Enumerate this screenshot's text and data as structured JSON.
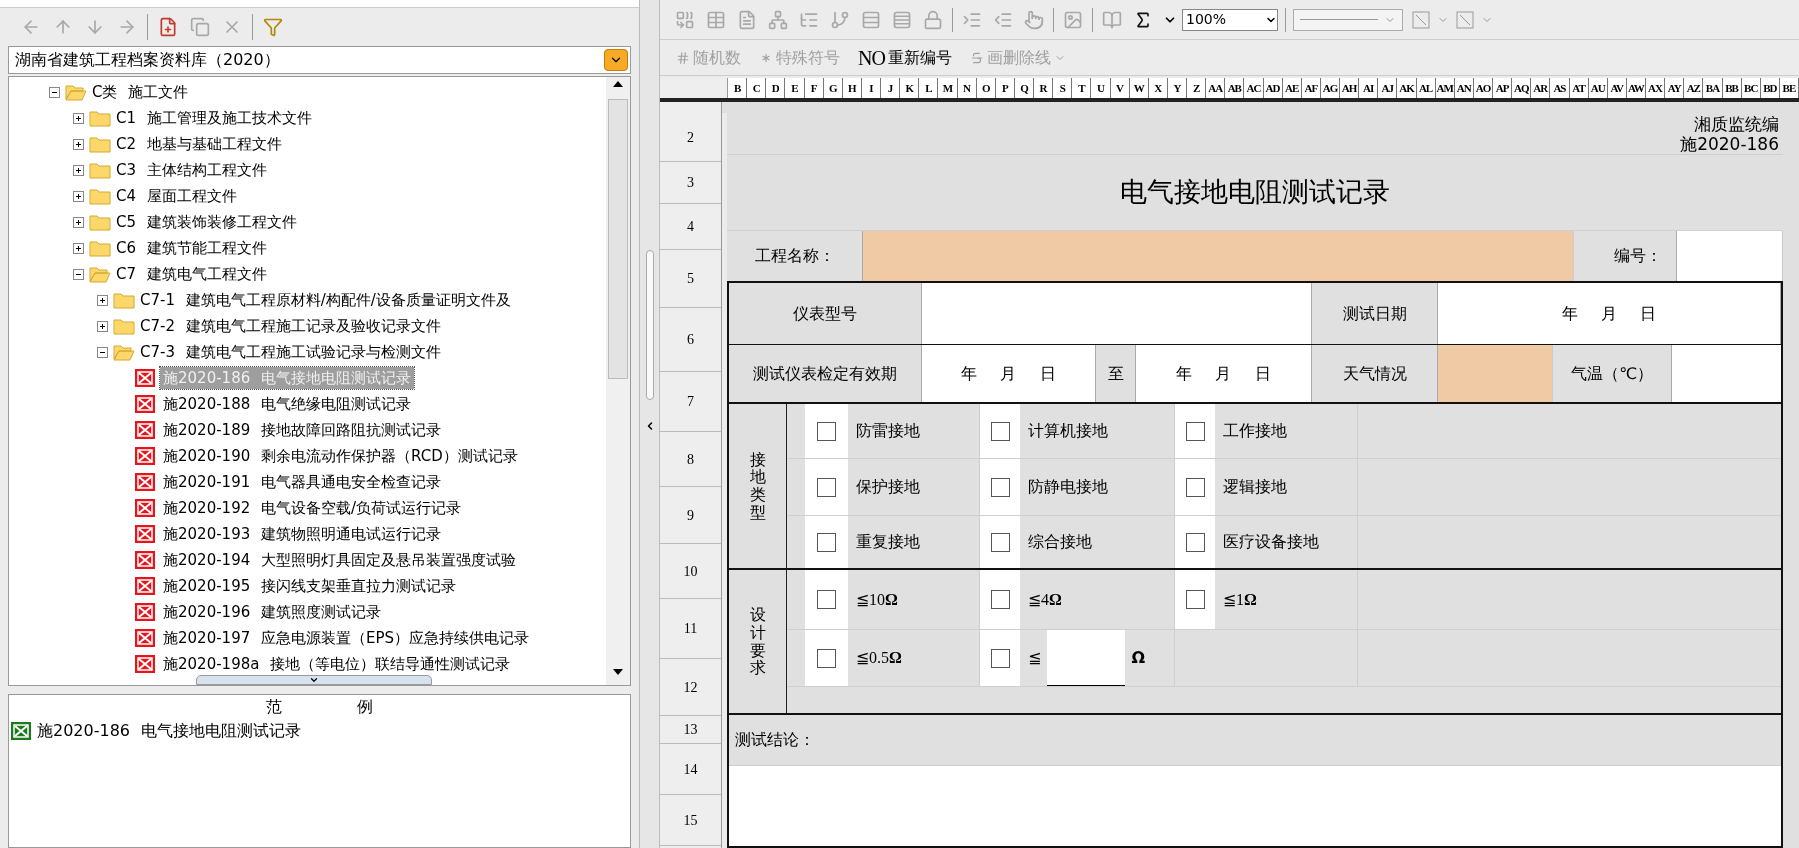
{
  "left_toolbar": [
    {
      "kind": "arrow-left",
      "disabled": true
    },
    {
      "kind": "arrow-up",
      "disabled": true
    },
    {
      "kind": "arrow-down",
      "disabled": true
    },
    {
      "kind": "arrow-right",
      "disabled": true
    },
    {
      "kind": "new-document",
      "disabled": false
    },
    {
      "kind": "copy",
      "disabled": true
    },
    {
      "kind": "delete",
      "disabled": true
    },
    {
      "kind": "filter",
      "disabled": false
    }
  ],
  "library_select": {
    "value": "湖南省建筑工程档案资料库（2020）"
  },
  "tree": [
    {
      "kind": "folder",
      "label": "C类 施工文件",
      "expanded": true,
      "children": [
        {
          "kind": "folder",
          "label": "C1 施工管理及施工技术文件",
          "expanded": false
        },
        {
          "kind": "folder",
          "label": "C2 地基与基础工程文件",
          "expanded": false
        },
        {
          "kind": "folder",
          "label": "C3 主体结构工程文件",
          "expanded": false
        },
        {
          "kind": "folder",
          "label": "C4 屋面工程文件",
          "expanded": false
        },
        {
          "kind": "folder",
          "label": "C5 建筑装饰装修工程文件",
          "expanded": false
        },
        {
          "kind": "folder",
          "label": "C6 建筑节能工程文件",
          "expanded": false
        },
        {
          "kind": "folder",
          "label": "C7 建筑电气工程文件",
          "expanded": true,
          "children": [
            {
              "kind": "folder",
              "label": "C7-1 建筑电气工程原材料/构配件/设备质量证明文件及",
              "expanded": false
            },
            {
              "kind": "folder",
              "label": "C7-2 建筑电气工程施工记录及验收记录文件",
              "expanded": false
            },
            {
              "kind": "folder",
              "label": "C7-3 建筑电气工程施工试验记录与检测文件",
              "expanded": true,
              "children": [
                {
                  "kind": "document",
                  "label": "施2020-186 电气接地电阻测试记录",
                  "selected": true
                },
                {
                  "kind": "document",
                  "label": "施2020-188 电气绝缘电阻测试记录",
                  "selected": false
                },
                {
                  "kind": "document",
                  "label": "施2020-189 接地故障回路阻抗测试记录",
                  "selected": false
                },
                {
                  "kind": "document",
                  "label": "施2020-190 剩余电流动作保护器（RCD）测试记录",
                  "selected": false
                },
                {
                  "kind": "document",
                  "label": "施2020-191 电气器具通电安全检查记录",
                  "selected": false
                },
                {
                  "kind": "document",
                  "label": "施2020-192 电气设备空载/负荷试运行记录",
                  "selected": false
                },
                {
                  "kind": "document",
                  "label": "施2020-193 建筑物照明通电试运行记录",
                  "selected": false
                },
                {
                  "kind": "document",
                  "label": "施2020-194 大型照明灯具固定及悬吊装置强度试验",
                  "selected": false
                },
                {
                  "kind": "document",
                  "label": "施2020-195 接闪线支架垂直拉力测试记录",
                  "selected": false
                },
                {
                  "kind": "document",
                  "label": "施2020-196 建筑照度测试记录",
                  "selected": false
                },
                {
                  "kind": "document",
                  "label": "施2020-197 应急电源装置（EPS）应急持续供电记录",
                  "selected": false
                },
                {
                  "kind": "document",
                  "label": "施2020-198a 接地（等电位）联结导通性测试记录",
                  "selected": false
                }
              ]
            }
          ]
        }
      ]
    }
  ],
  "preview": {
    "heading": "范 例",
    "items": [
      {
        "label": "施2020-186 电气接地电阻测试记录"
      }
    ]
  },
  "format_toolbar": [
    {
      "kind": "merge",
      "disabled": true
    },
    {
      "kind": "table",
      "disabled": true
    },
    {
      "kind": "form",
      "disabled": true
    },
    {
      "kind": "network",
      "disabled": true
    },
    {
      "kind": "list-tree",
      "disabled": true
    },
    {
      "kind": "branch",
      "disabled": true
    },
    {
      "kind": "rows",
      "disabled": true
    },
    {
      "kind": "rows-alt",
      "disabled": true
    },
    {
      "kind": "lock",
      "disabled": true
    },
    {
      "kind": "indent",
      "disabled": true
    },
    {
      "kind": "outdent",
      "disabled": true
    },
    {
      "kind": "pointer",
      "disabled": true
    },
    {
      "kind": "image",
      "disabled": true
    },
    {
      "kind": "book",
      "disabled": true
    },
    {
      "kind": "sum",
      "disabled": false
    }
  ],
  "zoom_select": {
    "value": "100%"
  },
  "edit_toolbar": [
    {
      "kind": "random",
      "label": "随机数",
      "disabled": true
    },
    {
      "kind": "symbol",
      "label": "特殊符号",
      "disabled": true
    },
    {
      "kind": "renumber",
      "badge": "NO",
      "label": "重新编号",
      "disabled": false
    },
    {
      "kind": "strike",
      "label": "画删除线",
      "disabled": true
    }
  ],
  "sheet": {
    "columns": [
      "B",
      "C",
      "D",
      "E",
      "F",
      "G",
      "H",
      "I",
      "J",
      "K",
      "L",
      "M",
      "N",
      "O",
      "P",
      "Q",
      "R",
      "S",
      "T",
      "U",
      "V",
      "W",
      "X",
      "Y",
      "Z",
      "AA",
      "AB",
      "AC",
      "AD",
      "AE",
      "AF",
      "AG",
      "AH",
      "AI",
      "AJ",
      "AK",
      "AL",
      "AM",
      "AN",
      "AO",
      "AP",
      "AQ",
      "AR",
      "AS",
      "AT",
      "AU",
      "AV",
      "AW",
      "AX",
      "AY",
      "AZ",
      "BA",
      "BB",
      "BC",
      "BD",
      "BE"
    ],
    "row_numbers": [
      "2",
      "3",
      "4",
      "5",
      "6",
      "7",
      "8",
      "9",
      "10",
      "11",
      "12",
      "13",
      "14",
      "15"
    ]
  },
  "form": {
    "code_lines": [
      "湘质监统编",
      "施2020-186"
    ],
    "title": "电气接地电阻测试记录",
    "project_label": "工程名称：",
    "project_field": {
      "highlighted": true
    },
    "number_label": "编号：",
    "number_field": {
      "highlighted": false
    },
    "instrument_model_label": "仪表型号",
    "test_date_label": "测试日期",
    "test_date_value": "年 月 日",
    "validity_label": "测试仪表检定有效期",
    "validity_from": "年 月 日",
    "to_label": "至",
    "validity_to": "年 月 日",
    "weather_label": "天气情况",
    "weather_field": {
      "highlighted": true
    },
    "temperature_label": "气温（℃）",
    "grounding_types": {
      "label": "接地类型",
      "options": [
        {
          "label": "防雷接地",
          "checked": false
        },
        {
          "label": "计算机接地",
          "checked": false
        },
        {
          "label": "工作接地",
          "checked": false
        },
        {
          "label": "保护接地",
          "checked": false
        },
        {
          "label": "防静电接地",
          "checked": false
        },
        {
          "label": "逻辑接地",
          "checked": false
        },
        {
          "label": "重复接地",
          "checked": false
        },
        {
          "label": "综合接地",
          "checked": false
        },
        {
          "label": "医疗设备接地",
          "checked": false
        }
      ]
    },
    "design_requirements": {
      "label": "设计要求",
      "options": [
        {
          "kind": "fixed",
          "label": "≦10**Ω**",
          "checked": false
        },
        {
          "kind": "fixed",
          "label": "≦4**Ω**",
          "checked": false
        },
        {
          "kind": "fixed",
          "label": "≦1**Ω**",
          "checked": false
        },
        {
          "kind": "fixed",
          "label": "≦0.5**Ω**",
          "checked": false
        },
        {
          "kind": "custom",
          "prefix": "≦",
          "unit": "Ω",
          "checked": false
        }
      ]
    },
    "conclusion_label": "测试结论："
  }
}
